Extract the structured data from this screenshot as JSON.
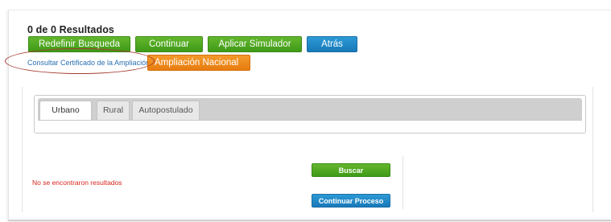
{
  "results": {
    "title": "0 de 0 Resultados"
  },
  "toolbar": {
    "redefinir_label": "Redefinir Busqueda",
    "continuar_label": "Continuar",
    "aplicar_label": "Aplicar Simulador",
    "atras_label": "Atrás"
  },
  "links": {
    "certificado_label": "Consultar Certificado de la Ampliación",
    "ampliacion_label": "Ampliación Nacional"
  },
  "tabs": [
    {
      "label": "Urbano",
      "active": true
    },
    {
      "label": "Rural",
      "active": false
    },
    {
      "label": "Autopostulado",
      "active": false
    }
  ],
  "search_area": {
    "no_results_text": "No se encontraron resultados",
    "buscar_label": "Buscar",
    "continuar_proceso_label": "Continuar Proceso"
  },
  "colors": {
    "green": "#4ea81f",
    "blue": "#1f88c8",
    "orange": "#ef8a1c",
    "error_red": "#d7261e",
    "annotation_red": "#a33b30"
  }
}
